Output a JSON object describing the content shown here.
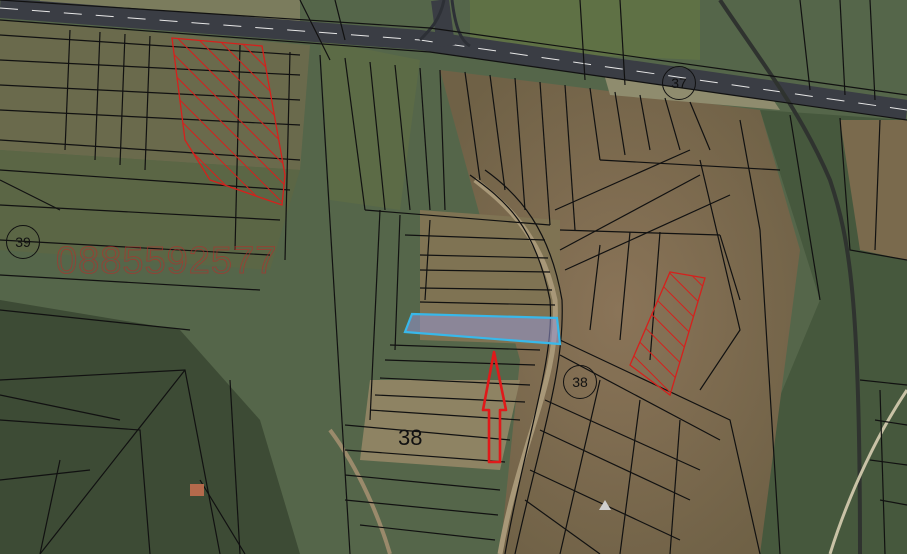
{
  "map": {
    "watermark_phone": "0885592577",
    "plot_label": "38",
    "road_badges": [
      {
        "id": "37",
        "label": "37"
      },
      {
        "id": "39",
        "label": "39"
      },
      {
        "id": "38",
        "label": "38"
      }
    ],
    "colors": {
      "highlight_parcel": "#38b8ea",
      "hatched_parcels": "#d6201c",
      "arrow": "#e0191a",
      "road": "#3a3d44",
      "cadastral_lines": "#111111"
    },
    "icons": [
      "north-arrow-icon"
    ]
  }
}
